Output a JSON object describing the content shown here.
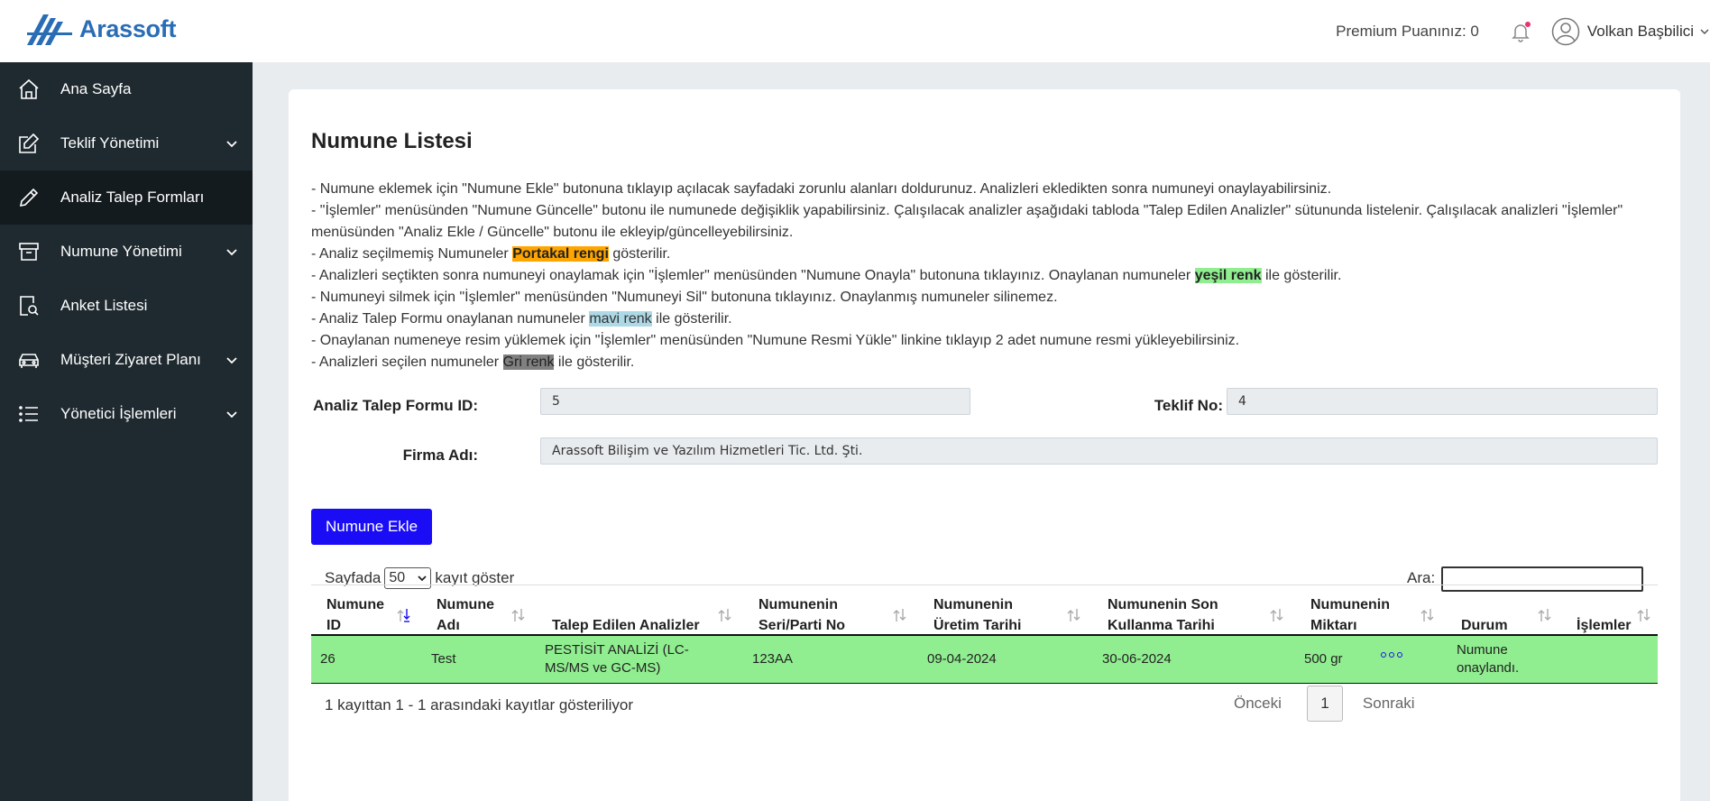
{
  "app": {
    "brand": "Arassoft"
  },
  "header": {
    "premium_text": "Premium Puanınız: 0",
    "user_name": "Volkan Başbilici"
  },
  "sidebar": {
    "items": [
      {
        "label": "Ana Sayfa",
        "icon": "home-icon",
        "has_submenu": false,
        "active": false
      },
      {
        "label": "Teklif Yönetimi",
        "icon": "edit-icon",
        "has_submenu": true,
        "active": false
      },
      {
        "label": "Analiz Talep Formları",
        "icon": "pencil-icon",
        "has_submenu": false,
        "active": true
      },
      {
        "label": "Numune Yönetimi",
        "icon": "archive-icon",
        "has_submenu": true,
        "active": false
      },
      {
        "label": "Anket Listesi",
        "icon": "survey-icon",
        "has_submenu": false,
        "active": false
      },
      {
        "label": "Müşteri Ziyaret Planı",
        "icon": "car-icon",
        "has_submenu": true,
        "active": false
      },
      {
        "label": "Yönetici İşlemleri",
        "icon": "list-icon",
        "has_submenu": true,
        "active": false
      }
    ]
  },
  "main": {
    "title": "Numune Listesi",
    "instructions": {
      "line1": "- Numune eklemek için \"Numune Ekle\" butonuna tıklayıp açılacak sayfadaki zorunlu alanları doldurunuz. Analizleri ekledikten sonra numuneyi onaylayabilirsiniz.",
      "line2": "- \"İşlemler\" menüsünden \"Numune Güncelle\" butonu ile numunede değişiklik yapabilirsiniz. Çalışılacak analizler aşağıdaki tabloda \"Talep Edilen Analizler\" sütununda listelenir. Çalışılacak analizleri \"İşlemler\" menüsünden \"Analiz Ekle / Güncelle\" butonu ile ekleyip/güncelleyebilirsiniz.",
      "line3_pre": "- Analiz seçilmemiş Numuneler ",
      "line3_hl": "Portakal rengi",
      "line3_post": " gösterilir.",
      "line4_pre": "- Analizleri seçtikten sonra numuneyi onaylamak için \"İşlemler\" menüsünden \"Numune Onayla\" butonuna tıklayınız. Onaylanan numuneler ",
      "line4_hl": "yeşil renk",
      "line4_post": " ile gösterilir.",
      "line5": "- Numuneyi silmek için \"İşlemler\" menüsünden \"Numuneyi Sil\" butonuna tıklayınız. Onaylanmış numuneler silinemez.",
      "line6_pre": "- Analiz Talep Formu onaylanan numuneler ",
      "line6_hl": "mavi renk",
      "line6_post": " ile gösterilir.",
      "line7": "- Onaylanan numeneye resim yüklemek için \"İşlemler\" menüsünden \"Numune Resmi Yükle\" linkine tıklayıp 2 adet numune resmi yükleyebilirsiniz.",
      "line8_pre": "- Analizleri seçilen numuneler ",
      "line8_hl": "Gri renk",
      "line8_post": " ile gösterilir."
    },
    "form": {
      "form_id_label": "Analiz Talep Formu ID:",
      "form_id_value": "5",
      "offer_label": "Teklif No:",
      "offer_value": "4",
      "company_label": "Firma Adı:",
      "company_value": "Arassoft Bilişim ve Yazılım Hizmetleri Tic. Ltd. Şti."
    },
    "add_button": "Numune Ekle",
    "table_controls": {
      "length_pre": "Sayfada",
      "length_value": "50",
      "length_post": "kayıt göster",
      "search_label": "Ara:"
    },
    "table": {
      "headers": [
        "Numune ID",
        "Numune Adı",
        "Talep Edilen Analizler",
        "Numunenin Seri/Parti No",
        "Numunenin Üretim Tarihi",
        "Numunenin Son Kullanma Tarihi",
        "Numunenin Miktarı",
        "Durum",
        "İşlemler"
      ],
      "rows": [
        {
          "id": "26",
          "name": "Test",
          "analyses": "PESTİSİT ANALİZİ (LC-MS/MS ve GC-MS)",
          "batch": "123AA",
          "production_date": "09-04-2024",
          "expiry_date": "30-06-2024",
          "amount": "500 gr",
          "status": "Numune onaylandı.",
          "row_color": "#90ee90"
        }
      ]
    },
    "footer": {
      "info": "1 kayıttan 1 - 1 arasındaki kayıtlar gösteriliyor",
      "prev": "Önceki",
      "page": "1",
      "next": "Sonraki"
    }
  },
  "colors": {
    "sidebar_bg": "#1f2a30",
    "sidebar_active": "#141b1f",
    "brand_blue": "#2a6db5",
    "add_button": "#1a0df5",
    "approved_row": "#90ee90",
    "orange_hl": "#ffa500",
    "blue_hl": "#add8e6",
    "grey_hl": "#808080"
  }
}
